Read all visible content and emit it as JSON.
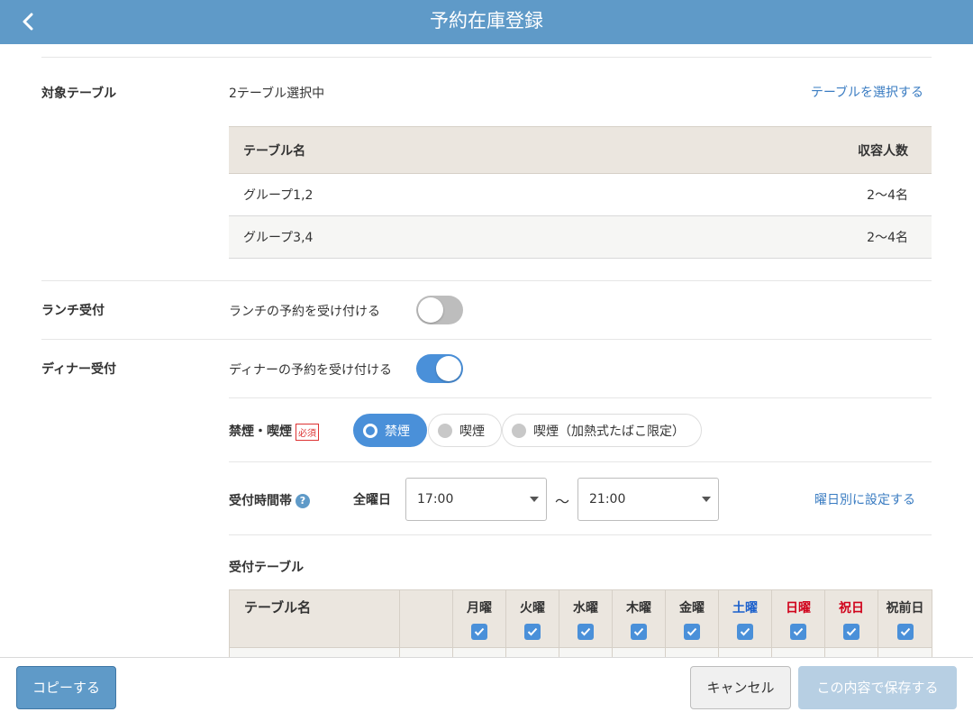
{
  "header": {
    "title": "予約在庫登録"
  },
  "target_table": {
    "label": "対象テーブル",
    "selected_text": "2テーブル選択中",
    "select_link": "テーブルを選択する",
    "columns": [
      "テーブル名",
      "収容人数"
    ],
    "rows": [
      {
        "name": "グループ1,2",
        "capacity": "2〜4名"
      },
      {
        "name": "グループ3,4",
        "capacity": "2〜4名"
      }
    ]
  },
  "lunch": {
    "label": "ランチ受付",
    "toggle_text": "ランチの予約を受け付ける",
    "enabled": false
  },
  "dinner": {
    "label": "ディナー受付",
    "toggle_text": "ディナーの予約を受け付ける",
    "enabled": true
  },
  "smoking": {
    "label": "禁煙・喫煙",
    "required_badge": "必須",
    "options": [
      "禁煙",
      "喫煙",
      "喫煙（加熱式たばこ限定）"
    ],
    "selected": "禁煙"
  },
  "reception_time": {
    "label": "受付時間帯",
    "help_icon": "?",
    "day_label": "全曜日",
    "start": "17:00",
    "separator": "〜",
    "end": "21:00",
    "per_day_link": "曜日別に設定する"
  },
  "reception_table": {
    "label": "受付テーブル",
    "name_header": "テーブル名",
    "days": [
      {
        "label": "月曜",
        "color": "#333333",
        "checked": true
      },
      {
        "label": "火曜",
        "color": "#333333",
        "checked": true
      },
      {
        "label": "水曜",
        "color": "#333333",
        "checked": true
      },
      {
        "label": "木曜",
        "color": "#333333",
        "checked": true
      },
      {
        "label": "金曜",
        "color": "#333333",
        "checked": true
      },
      {
        "label": "土曜",
        "color": "#1a5fcc",
        "checked": true
      },
      {
        "label": "日曜",
        "color": "#d0021b",
        "checked": true
      },
      {
        "label": "祝日",
        "color": "#d0021b",
        "checked": true
      },
      {
        "label": "祝前日",
        "color": "#333333",
        "checked": true
      }
    ]
  },
  "footer": {
    "copy": "コピーする",
    "cancel": "キャンセル",
    "save": "この内容で保存する"
  },
  "colors": {
    "header": "#5f9ac8",
    "accent": "#4a90d9",
    "link": "#3a7cc2"
  }
}
